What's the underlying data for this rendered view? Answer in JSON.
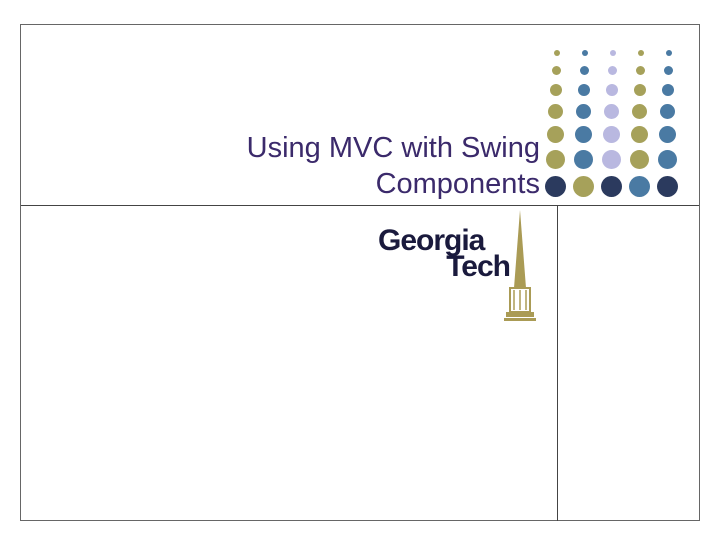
{
  "title": {
    "line1": "Using MVC with Swing",
    "line2": "Components"
  },
  "logo": {
    "line1": "Georgia",
    "line2": "Tech"
  },
  "colors": {
    "title_text": "#3b2a6b",
    "dot_olive": "#a6a15a",
    "dot_blue": "#4a7aa3",
    "dot_lavender": "#b9b8e0",
    "dot_navy": "#2b3a5e",
    "logo_color": "#1a1a3d",
    "tower_color": "#aa9b55"
  }
}
